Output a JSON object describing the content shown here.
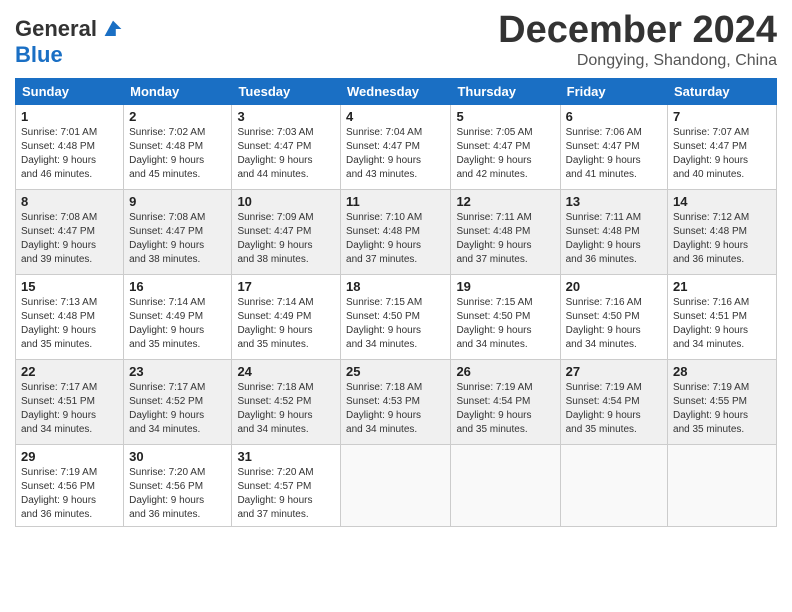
{
  "header": {
    "logo_line1": "General",
    "logo_line2": "Blue",
    "month": "December 2024",
    "location": "Dongying, Shandong, China"
  },
  "weekdays": [
    "Sunday",
    "Monday",
    "Tuesday",
    "Wednesday",
    "Thursday",
    "Friday",
    "Saturday"
  ],
  "weeks": [
    [
      {
        "day": 1,
        "info": "Sunrise: 7:01 AM\nSunset: 4:48 PM\nDaylight: 9 hours\nand 46 minutes."
      },
      {
        "day": 2,
        "info": "Sunrise: 7:02 AM\nSunset: 4:48 PM\nDaylight: 9 hours\nand 45 minutes."
      },
      {
        "day": 3,
        "info": "Sunrise: 7:03 AM\nSunset: 4:47 PM\nDaylight: 9 hours\nand 44 minutes."
      },
      {
        "day": 4,
        "info": "Sunrise: 7:04 AM\nSunset: 4:47 PM\nDaylight: 9 hours\nand 43 minutes."
      },
      {
        "day": 5,
        "info": "Sunrise: 7:05 AM\nSunset: 4:47 PM\nDaylight: 9 hours\nand 42 minutes."
      },
      {
        "day": 6,
        "info": "Sunrise: 7:06 AM\nSunset: 4:47 PM\nDaylight: 9 hours\nand 41 minutes."
      },
      {
        "day": 7,
        "info": "Sunrise: 7:07 AM\nSunset: 4:47 PM\nDaylight: 9 hours\nand 40 minutes."
      }
    ],
    [
      {
        "day": 8,
        "info": "Sunrise: 7:08 AM\nSunset: 4:47 PM\nDaylight: 9 hours\nand 39 minutes."
      },
      {
        "day": 9,
        "info": "Sunrise: 7:08 AM\nSunset: 4:47 PM\nDaylight: 9 hours\nand 38 minutes."
      },
      {
        "day": 10,
        "info": "Sunrise: 7:09 AM\nSunset: 4:47 PM\nDaylight: 9 hours\nand 38 minutes."
      },
      {
        "day": 11,
        "info": "Sunrise: 7:10 AM\nSunset: 4:48 PM\nDaylight: 9 hours\nand 37 minutes."
      },
      {
        "day": 12,
        "info": "Sunrise: 7:11 AM\nSunset: 4:48 PM\nDaylight: 9 hours\nand 37 minutes."
      },
      {
        "day": 13,
        "info": "Sunrise: 7:11 AM\nSunset: 4:48 PM\nDaylight: 9 hours\nand 36 minutes."
      },
      {
        "day": 14,
        "info": "Sunrise: 7:12 AM\nSunset: 4:48 PM\nDaylight: 9 hours\nand 36 minutes."
      }
    ],
    [
      {
        "day": 15,
        "info": "Sunrise: 7:13 AM\nSunset: 4:48 PM\nDaylight: 9 hours\nand 35 minutes."
      },
      {
        "day": 16,
        "info": "Sunrise: 7:14 AM\nSunset: 4:49 PM\nDaylight: 9 hours\nand 35 minutes."
      },
      {
        "day": 17,
        "info": "Sunrise: 7:14 AM\nSunset: 4:49 PM\nDaylight: 9 hours\nand 35 minutes."
      },
      {
        "day": 18,
        "info": "Sunrise: 7:15 AM\nSunset: 4:50 PM\nDaylight: 9 hours\nand 34 minutes."
      },
      {
        "day": 19,
        "info": "Sunrise: 7:15 AM\nSunset: 4:50 PM\nDaylight: 9 hours\nand 34 minutes."
      },
      {
        "day": 20,
        "info": "Sunrise: 7:16 AM\nSunset: 4:50 PM\nDaylight: 9 hours\nand 34 minutes."
      },
      {
        "day": 21,
        "info": "Sunrise: 7:16 AM\nSunset: 4:51 PM\nDaylight: 9 hours\nand 34 minutes."
      }
    ],
    [
      {
        "day": 22,
        "info": "Sunrise: 7:17 AM\nSunset: 4:51 PM\nDaylight: 9 hours\nand 34 minutes."
      },
      {
        "day": 23,
        "info": "Sunrise: 7:17 AM\nSunset: 4:52 PM\nDaylight: 9 hours\nand 34 minutes."
      },
      {
        "day": 24,
        "info": "Sunrise: 7:18 AM\nSunset: 4:52 PM\nDaylight: 9 hours\nand 34 minutes."
      },
      {
        "day": 25,
        "info": "Sunrise: 7:18 AM\nSunset: 4:53 PM\nDaylight: 9 hours\nand 34 minutes."
      },
      {
        "day": 26,
        "info": "Sunrise: 7:19 AM\nSunset: 4:54 PM\nDaylight: 9 hours\nand 35 minutes."
      },
      {
        "day": 27,
        "info": "Sunrise: 7:19 AM\nSunset: 4:54 PM\nDaylight: 9 hours\nand 35 minutes."
      },
      {
        "day": 28,
        "info": "Sunrise: 7:19 AM\nSunset: 4:55 PM\nDaylight: 9 hours\nand 35 minutes."
      }
    ],
    [
      {
        "day": 29,
        "info": "Sunrise: 7:19 AM\nSunset: 4:56 PM\nDaylight: 9 hours\nand 36 minutes."
      },
      {
        "day": 30,
        "info": "Sunrise: 7:20 AM\nSunset: 4:56 PM\nDaylight: 9 hours\nand 36 minutes."
      },
      {
        "day": 31,
        "info": "Sunrise: 7:20 AM\nSunset: 4:57 PM\nDaylight: 9 hours\nand 37 minutes."
      },
      null,
      null,
      null,
      null
    ]
  ]
}
